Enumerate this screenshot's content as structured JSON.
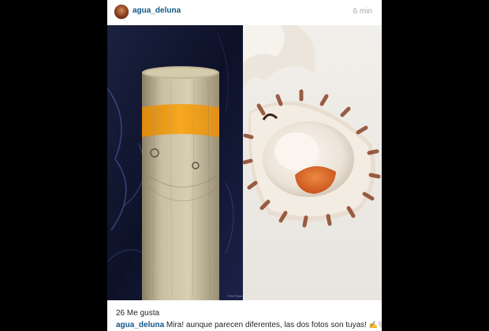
{
  "post": {
    "username": "agua_deluna",
    "time": "6 min",
    "likes": "26 Me gusta",
    "caption_user": "agua_deluna",
    "caption_text": "Mira! aunque parecen diferentes, las dos fotos son tuyas!",
    "caption_emoji": "✍🐚"
  },
  "photo": {
    "watermark": "©Rb Photos"
  },
  "colors": {
    "username": "#125688",
    "muted": "#a5a7aa",
    "background": "#000000",
    "post_orange": "#f2a51e"
  }
}
